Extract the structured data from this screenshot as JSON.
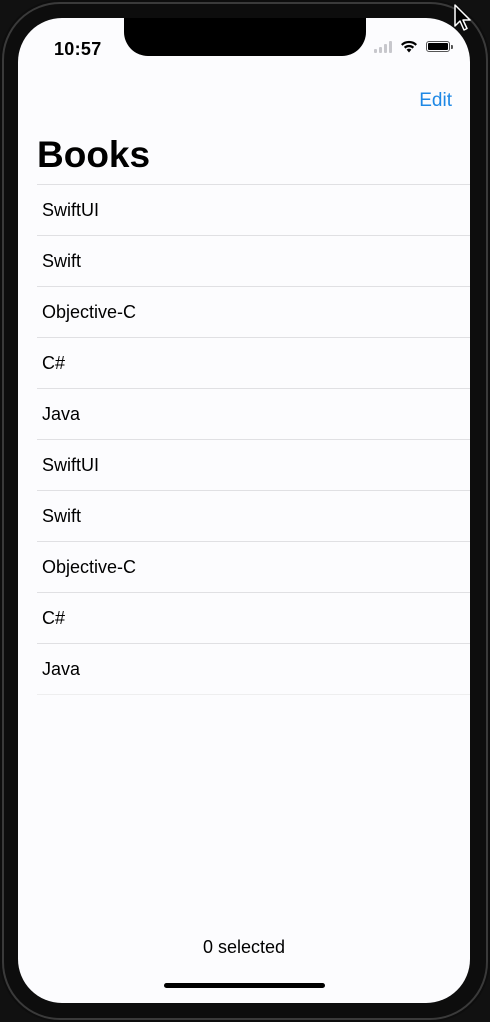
{
  "status_bar": {
    "time": "10:57",
    "icons": [
      "signal-icon",
      "wifi-icon",
      "battery-icon"
    ]
  },
  "nav": {
    "edit_label": "Edit",
    "title": "Books"
  },
  "books": [
    "SwiftUI",
    "Swift",
    "Objective-C",
    "C#",
    "Java",
    "SwiftUI",
    "Swift",
    "Objective-C",
    "C#",
    "Java"
  ],
  "footer": {
    "selection_status": "0 selected"
  },
  "colors": {
    "accent": "#1e88e5",
    "background": "#fcfcfe",
    "separator": "#e0e0e3"
  }
}
